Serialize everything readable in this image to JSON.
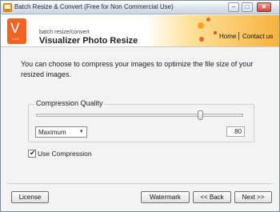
{
  "window": {
    "title": "Batch Resize & Convert (Free for Non Commercial Use)",
    "minimize_glyph": "–",
    "maximize_glyph": "□",
    "close_glyph": "✕"
  },
  "header": {
    "logo_letter": "V",
    "logo_subtext": "V12",
    "tagline": "batch resize/convert",
    "product_name": "Visualizer Photo Resize",
    "links": [
      "Home",
      "Contact us"
    ]
  },
  "main": {
    "description": "You can choose to compress your images to optimize the file size of your resized images.",
    "compression": {
      "group_label": "Compression Quality",
      "slider_level_percent": 80,
      "preset_selected": "Maximum",
      "dropdown_glyph": "▾",
      "quality_value": "80"
    },
    "use_compression": {
      "label": "Use Compression",
      "checked": true,
      "check_glyph": "✔"
    }
  },
  "footer": {
    "license_label": "License",
    "watermark_label": "Watermark",
    "back_label": "<< Back",
    "next_label": "Next >>"
  },
  "colors": {
    "logo": "#f26322",
    "header_accent": "#f7b33d"
  },
  "icons": {
    "app": "app-icon",
    "logo": "visualizer-logo-icon",
    "dropdown": "chevron-down-icon",
    "check": "checkmark-icon"
  }
}
